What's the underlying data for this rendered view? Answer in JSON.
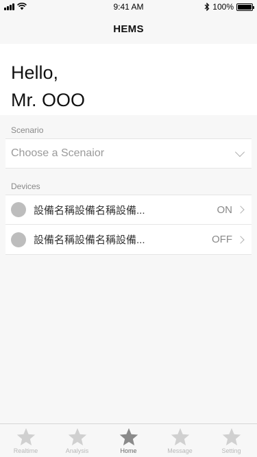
{
  "status_bar": {
    "time": "9:41 AM",
    "battery_text": "100%",
    "battery_level": 1.0
  },
  "nav": {
    "title": "HEMS"
  },
  "greeting": {
    "line1": "Hello,",
    "line2": "Mr. OOO"
  },
  "scenario": {
    "section_label": "Scenario",
    "placeholder": "Choose a Scenaior"
  },
  "devices": {
    "section_label": "Devices",
    "items": [
      {
        "name": "設備名稱設備名稱設備...",
        "state": "ON"
      },
      {
        "name": "設備名稱設備名稱設備...",
        "state": "OFF"
      }
    ]
  },
  "tab_bar": {
    "items": [
      {
        "label": "Realtime",
        "icon": "star-icon",
        "active": false
      },
      {
        "label": "Analysis",
        "icon": "star-icon",
        "active": false
      },
      {
        "label": "Home",
        "icon": "star-icon",
        "active": true
      },
      {
        "label": "Message",
        "icon": "star-icon",
        "active": false
      },
      {
        "label": "Setting",
        "icon": "star-icon",
        "active": false
      }
    ],
    "active_color": "#8a8a8a",
    "inactive_color": "#d0d0d0"
  }
}
